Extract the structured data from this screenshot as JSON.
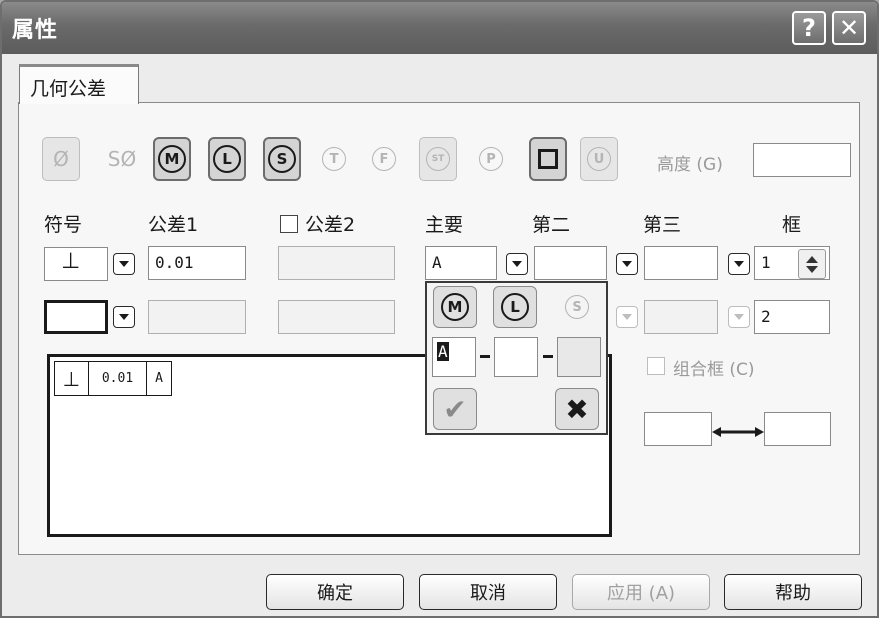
{
  "window": {
    "title": "属性",
    "help_label": "?",
    "close_label": "✕"
  },
  "tab": {
    "label": "几何公差"
  },
  "symbol_bar": {
    "items": [
      {
        "label": "Ø"
      },
      {
        "label": "SØ"
      },
      {
        "label": "M"
      },
      {
        "label": "L"
      },
      {
        "label": "S"
      },
      {
        "label": "T"
      },
      {
        "label": "F"
      },
      {
        "label": "ST"
      },
      {
        "label": "P"
      },
      {
        "label": ""
      },
      {
        "label": "U"
      }
    ],
    "height_label": "高度 (G)",
    "height_value": ""
  },
  "headers": {
    "symbol": "符号",
    "tolerance1": "公差1",
    "tolerance2": "公差2",
    "primary": "主要",
    "secondary": "第二",
    "tertiary": "第三",
    "frame": "框"
  },
  "row1": {
    "symbol": "⊥",
    "tolerance1": "0.01",
    "tolerance2": "",
    "primary": "A",
    "secondary": "",
    "tertiary": "",
    "frame": "1"
  },
  "row2": {
    "symbol": "",
    "tolerance1": "",
    "tolerance2": "",
    "primary": "",
    "secondary": "",
    "tertiary": "",
    "frame": "2"
  },
  "combine_frame": {
    "label": "组合框 (C)"
  },
  "range_fields": {
    "left": "",
    "right": ""
  },
  "preview": {
    "symbol": "⊥",
    "tolerance": "0.01",
    "datum": "A"
  },
  "popup": {
    "m_label": "M",
    "l_label": "L",
    "s_label": "S",
    "field1": "A",
    "field2": "",
    "field3": "",
    "ok_label": "✔",
    "cancel_label": "✖"
  },
  "buttons": {
    "ok": "确定",
    "cancel": "取消",
    "apply": "应用 (A)",
    "help": "帮助"
  }
}
